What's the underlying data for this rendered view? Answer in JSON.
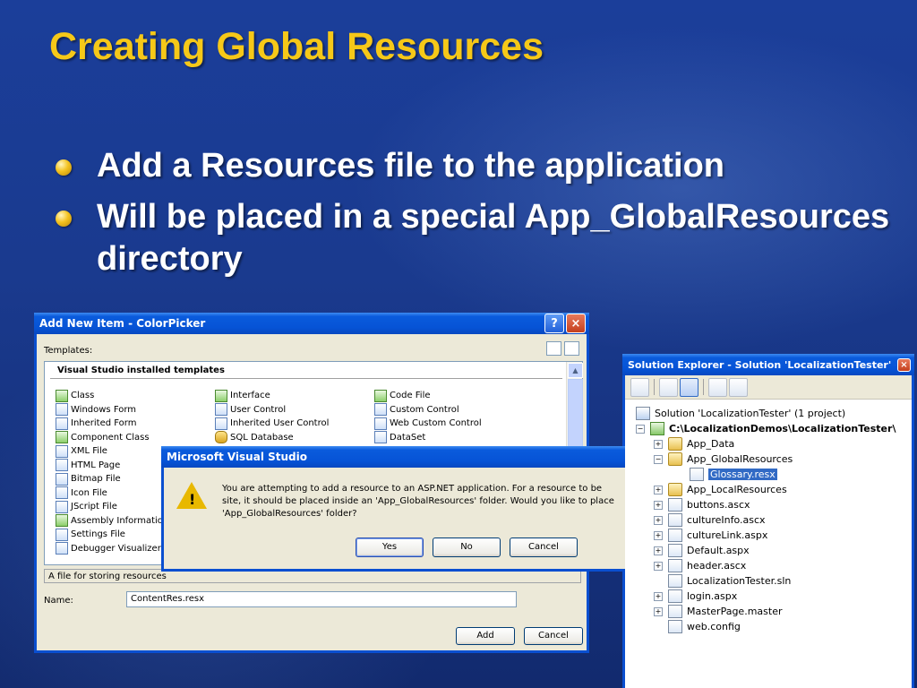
{
  "slide": {
    "title": "Creating Global Resources",
    "bullets": [
      "Add a Resources file to the application",
      "Will be placed in a special App_GlobalResources directory"
    ]
  },
  "add_new_item": {
    "title": "Add New Item - ColorPicker",
    "help_glyph": "?",
    "close_glyph": "×",
    "templates_label": "Templates:",
    "installed_header": "Visual Studio installed templates",
    "columns": [
      [
        "Class",
        "Windows Form",
        "Inherited Form",
        "Component Class",
        "XML File",
        "HTML Page",
        "Bitmap File",
        "Icon File",
        "JScript File",
        "Assembly Information F",
        "Settings File",
        "Debugger Visualizer"
      ],
      [
        "Interface",
        "User Control",
        "Inherited User Control",
        "SQL Database"
      ],
      [
        "Code File",
        "Custom Control",
        "Web Custom Control",
        "DataSet"
      ]
    ],
    "description": "A file for storing resources",
    "name_label": "Name:",
    "name_value": "ContentRes.resx",
    "add_label": "Add",
    "cancel_label": "Cancel"
  },
  "message_box": {
    "title": "Microsoft Visual Studio",
    "icon": "warning-icon",
    "line1": "You are attempting to add a resource to an ASP.NET application.  For a resource to be",
    "line2": "site, it should be placed inside an 'App_GlobalResources' folder.  Would you like to place",
    "line3": "'App_GlobalResources' folder?",
    "yes_label": "Yes",
    "no_label": "No",
    "cancel_label": "Cancel"
  },
  "solution_explorer": {
    "title": "Solution Explorer - Solution 'LocalizationTester' (...",
    "close_glyph": "×",
    "tree": {
      "solution": "Solution 'LocalizationTester' (1 project)",
      "project": "C:\\LocalizationDemos\\LocalizationTester\\",
      "items": [
        {
          "label": "App_Data",
          "type": "folder",
          "expander": "+"
        },
        {
          "label": "App_GlobalResources",
          "type": "folder",
          "expander": "−"
        },
        {
          "label": "Glossary.resx",
          "type": "file",
          "expander": "",
          "selected": true
        },
        {
          "label": "App_LocalResources",
          "type": "folder",
          "expander": "+"
        },
        {
          "label": "buttons.ascx",
          "type": "file",
          "expander": "+"
        },
        {
          "label": "cultureInfo.ascx",
          "type": "file",
          "expander": "+"
        },
        {
          "label": "cultureLink.aspx",
          "type": "file",
          "expander": "+"
        },
        {
          "label": "Default.aspx",
          "type": "file",
          "expander": "+"
        },
        {
          "label": "header.ascx",
          "type": "file",
          "expander": "+"
        },
        {
          "label": "LocalizationTester.sln",
          "type": "file",
          "expander": ""
        },
        {
          "label": "login.aspx",
          "type": "file",
          "expander": "+"
        },
        {
          "label": "MasterPage.master",
          "type": "file",
          "expander": "+"
        },
        {
          "label": "web.config",
          "type": "file",
          "expander": ""
        }
      ]
    }
  },
  "colors": {
    "title_yellow": "#f6c818",
    "xp_blue": "#0653d6",
    "selection_blue": "#316ac5"
  }
}
